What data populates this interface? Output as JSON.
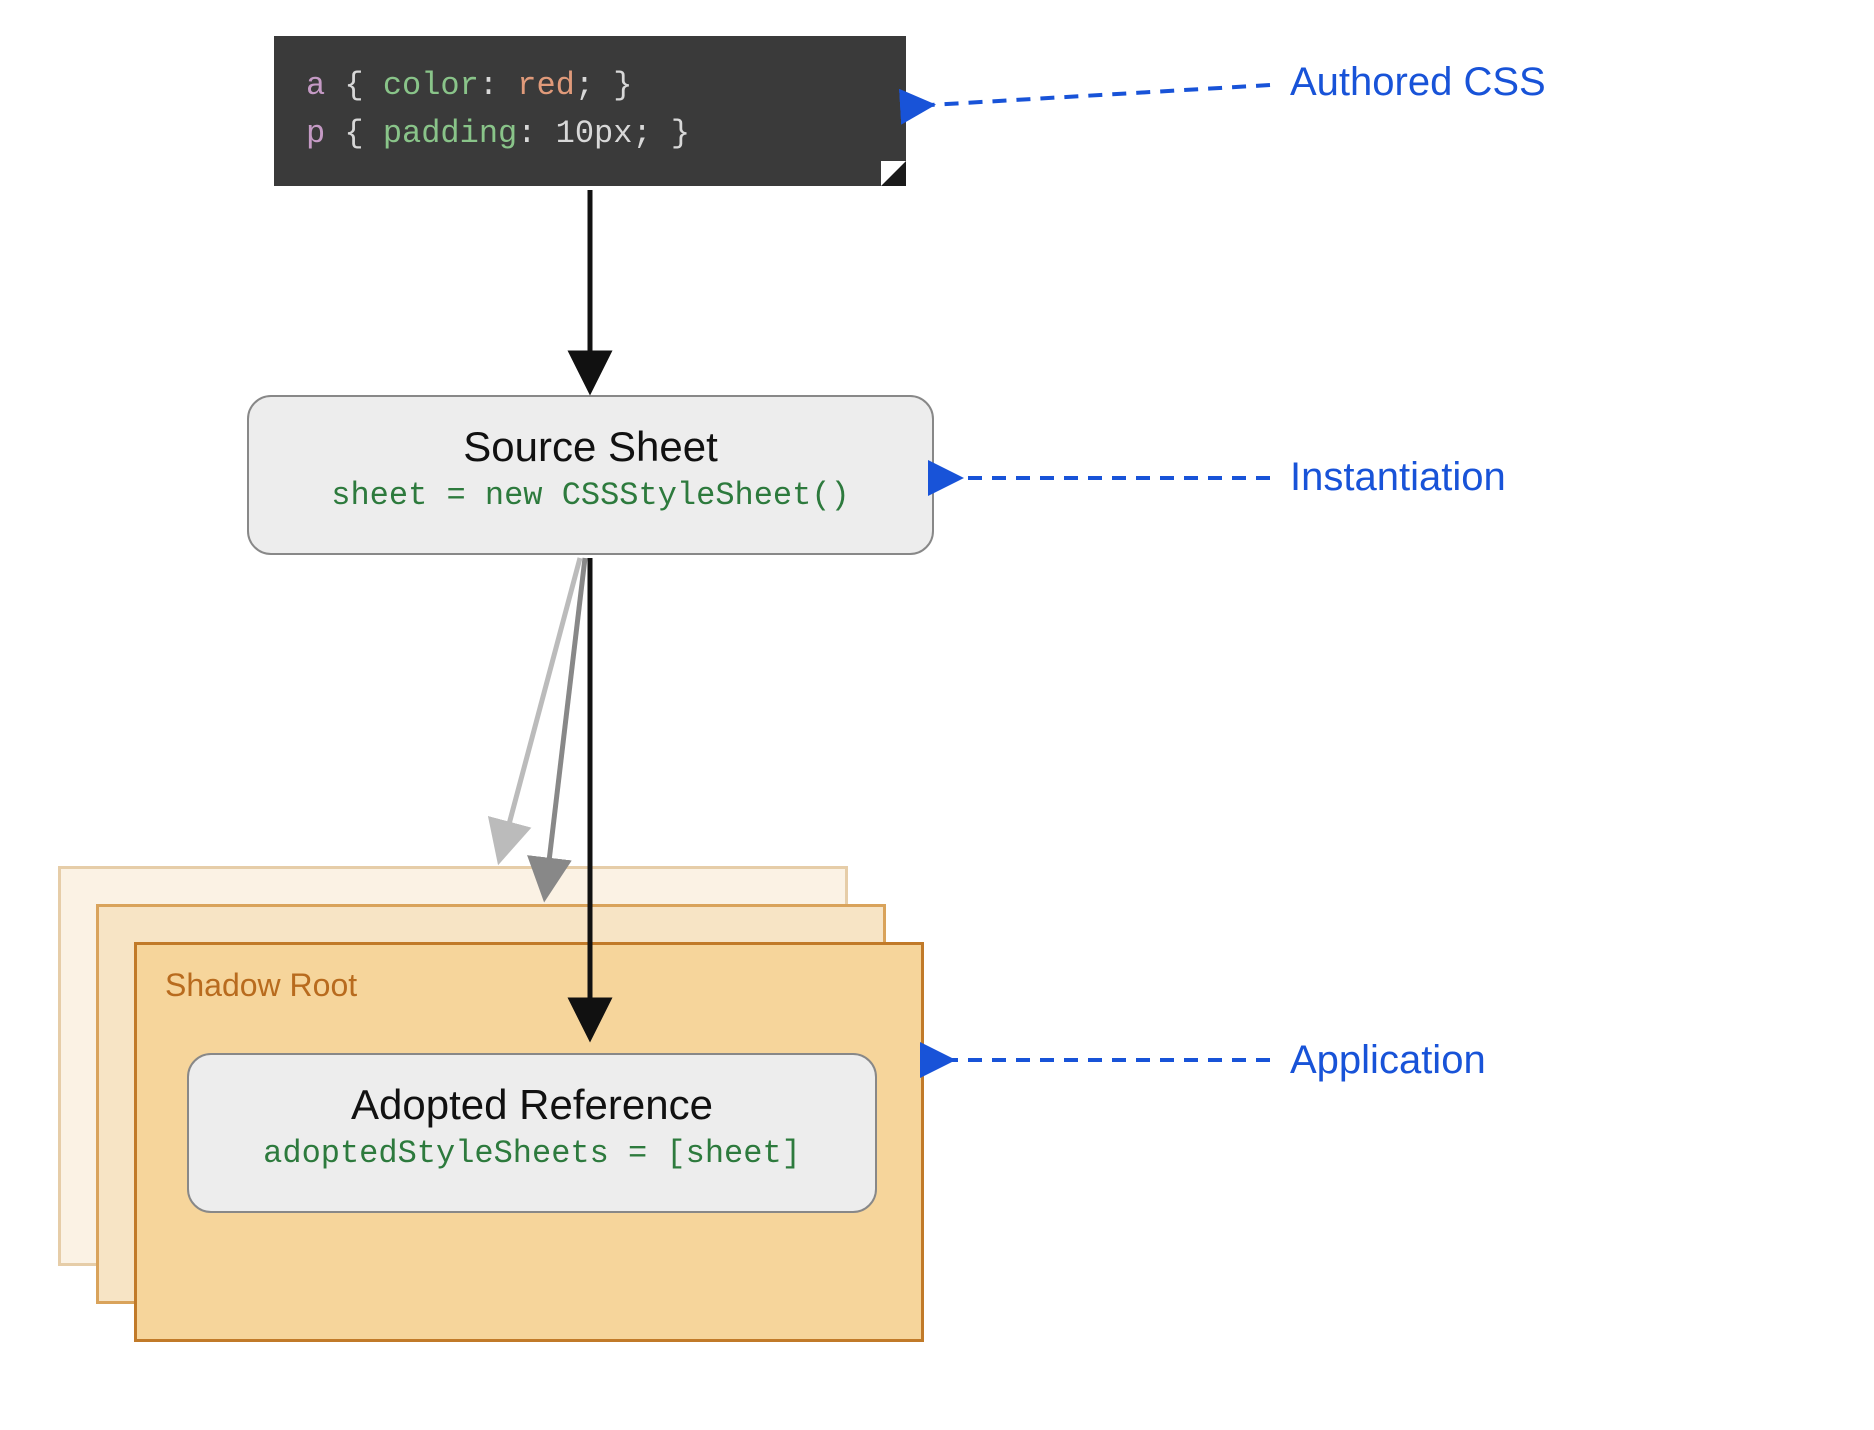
{
  "code": {
    "line1": {
      "sel": "a",
      "brace1": " { ",
      "prop": "color",
      "colon": ": ",
      "val": "red",
      "semi": "; ",
      "brace2": "}"
    },
    "line2": {
      "sel": "p",
      "brace1": " { ",
      "prop": "padding",
      "colon": ": ",
      "val": "10px",
      "semi": "; ",
      "brace2": "}"
    }
  },
  "source": {
    "title": "Source Sheet",
    "code": "sheet = new CSSStyleSheet()"
  },
  "shadow": {
    "label": "Shadow Root"
  },
  "adopted": {
    "title": "Adopted Reference",
    "code": "adoptedStyleSheets = [sheet]"
  },
  "annotations": {
    "authored": "Authored CSS",
    "instantiation": "Instantiation",
    "application": "Application"
  }
}
